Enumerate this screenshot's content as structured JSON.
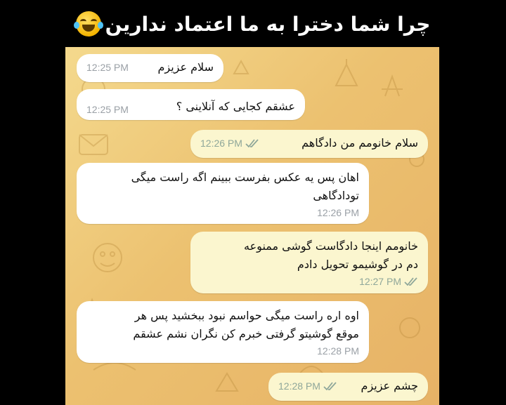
{
  "caption": {
    "text": "چرا شما دخترا به ما اعتماد ندارین",
    "emoji": "face-with-tears-of-joy-icon"
  },
  "messages": [
    {
      "direction": "incoming",
      "text": "سلام عزیزم",
      "time": "12:25 PM"
    },
    {
      "direction": "incoming",
      "text": "عشقم کجایی که آنلاینی ؟",
      "time": "12:25 PM"
    },
    {
      "direction": "outgoing",
      "text": "سلام خانومم من دادگاهم",
      "time": "12:26 PM",
      "status": "read"
    },
    {
      "direction": "incoming",
      "lines": [
        "اهان پس یه عکس بفرست ببینم اگه راست میگی",
        "تودادگاهی"
      ],
      "time": "12:26 PM"
    },
    {
      "direction": "outgoing",
      "lines": [
        "خانومم اینجا دادگاست گوشی ممنوعه",
        "دم در گوشیمو تحویل دادم"
      ],
      "time": "12:27 PM",
      "status": "read"
    },
    {
      "direction": "incoming",
      "lines": [
        "اوه اره راست میگی حواسم نبود ببخشید پس هر",
        "موقع گوشیتو گرفتی خبرم کن نگران نشم عشقم"
      ],
      "time": "12:28 PM"
    },
    {
      "direction": "outgoing",
      "text": "چشم عزیزم",
      "time": "12:28 PM",
      "status": "read"
    }
  ],
  "colors": {
    "incoming_bubble": "#ffffff",
    "outgoing_bubble": "#fbf6cf",
    "wallpaper": "#ecc170",
    "read_check": "#8fa79a"
  }
}
